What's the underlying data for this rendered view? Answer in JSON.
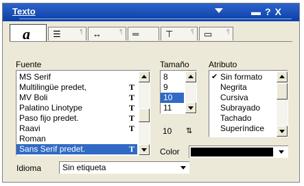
{
  "window": {
    "title": "Texto"
  },
  "tabs": [
    {
      "name": "tab-font",
      "glyph": "a"
    },
    {
      "name": "tab-paragraph",
      "glyph": "☰"
    },
    {
      "name": "tab-spacing",
      "glyph": "↔"
    },
    {
      "name": "tab-lines",
      "glyph": "═"
    },
    {
      "name": "tab-tabs",
      "glyph": "⊤"
    },
    {
      "name": "tab-border",
      "glyph": "▭"
    }
  ],
  "font": {
    "label": "Fuente",
    "items": [
      {
        "label": "MS Serif",
        "ttf": ""
      },
      {
        "label": "Multilingüe predet,",
        "ttf": "T"
      },
      {
        "label": "MV Boli",
        "ttf": "T"
      },
      {
        "label": "Palatino Linotype",
        "ttf": "T"
      },
      {
        "label": "Paso fijo predet.",
        "ttf": "T"
      },
      {
        "label": "Raavi",
        "ttf": "T"
      },
      {
        "label": "Roman",
        "ttf": ""
      },
      {
        "label": "Sans Serif predet.",
        "ttf": "T",
        "selected": true
      }
    ]
  },
  "size": {
    "label": "Tamaño",
    "items": [
      "8",
      "9",
      "10",
      "11"
    ],
    "selected": "10",
    "value": "10",
    "spin_icon": "up-down-arrows-icon"
  },
  "attribute": {
    "label": "Atributo",
    "items": [
      {
        "label": "Sin formato",
        "checked": true
      },
      {
        "label": "Negrita"
      },
      {
        "label": "Cursiva"
      },
      {
        "label": "Subrayado"
      },
      {
        "label": "Tachado"
      },
      {
        "label": "Superíndice"
      }
    ]
  },
  "color": {
    "label": "Color",
    "value": "#000000"
  },
  "language": {
    "label": "Idioma",
    "value": "Sin etiqueta"
  },
  "colors": {
    "titlebar": "#0a3fa8",
    "selection": "#316ac5",
    "panel": "#ece9d8"
  }
}
